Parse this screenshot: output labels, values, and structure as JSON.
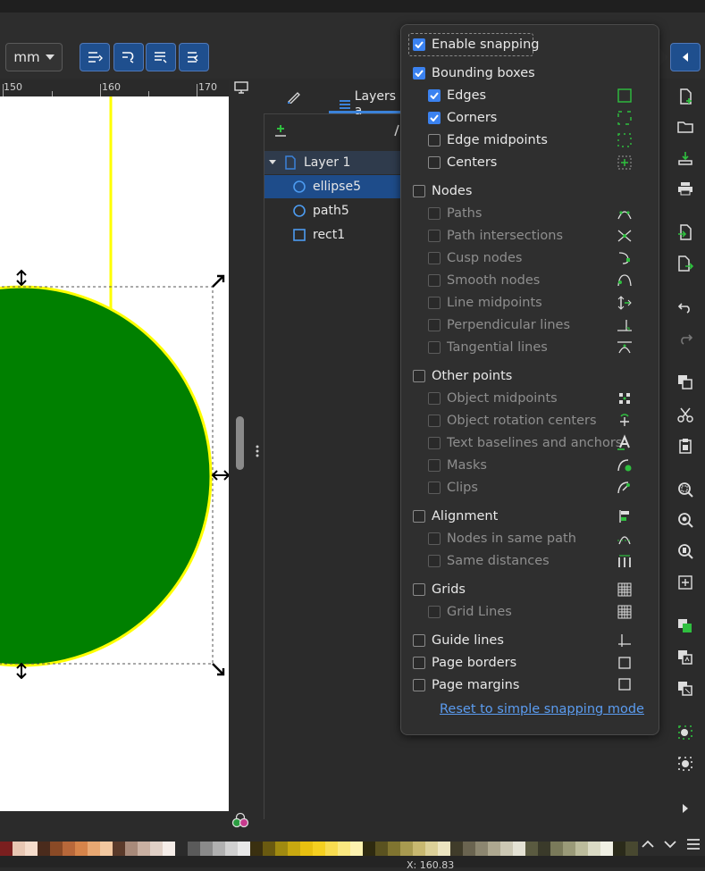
{
  "toolbar": {
    "unit": "mm"
  },
  "ruler": {
    "labels": [
      "150",
      "160",
      "170"
    ]
  },
  "layers_panel": {
    "tab_label": "Layers a",
    "rows": [
      {
        "label": "Layer 1",
        "type": "layer"
      },
      {
        "label": "ellipse5",
        "type": "ellipse",
        "selected": true
      },
      {
        "label": "path5",
        "type": "ellipse"
      },
      {
        "label": "rect1",
        "type": "rect"
      }
    ]
  },
  "snap_popover": {
    "enable": {
      "label": "Enable snapping",
      "checked": true
    },
    "bounding_boxes": {
      "label": "Bounding boxes",
      "checked": true
    },
    "edges": {
      "label": "Edges",
      "checked": true
    },
    "corners": {
      "label": "Corners",
      "checked": true
    },
    "edge_midpoints": {
      "label": "Edge midpoints",
      "checked": false
    },
    "centers": {
      "label": "Centers",
      "checked": false
    },
    "nodes": {
      "label": "Nodes",
      "checked": false
    },
    "paths": {
      "label": "Paths",
      "checked": false
    },
    "path_intersections": {
      "label": "Path intersections",
      "checked": false
    },
    "cusp_nodes": {
      "label": "Cusp nodes",
      "checked": false
    },
    "smooth_nodes": {
      "label": "Smooth nodes",
      "checked": false
    },
    "line_midpoints": {
      "label": "Line midpoints",
      "checked": false
    },
    "perpendicular_lines": {
      "label": "Perpendicular lines",
      "checked": false
    },
    "tangential_lines": {
      "label": "Tangential lines",
      "checked": false
    },
    "other_points": {
      "label": "Other points",
      "checked": false
    },
    "object_midpoints": {
      "label": "Object midpoints",
      "checked": false
    },
    "rotation_centers": {
      "label": "Object rotation centers",
      "checked": false
    },
    "text_baselines": {
      "label": "Text baselines and anchors",
      "checked": false
    },
    "masks": {
      "label": "Masks",
      "checked": false
    },
    "clips": {
      "label": "Clips",
      "checked": false
    },
    "alignment": {
      "label": "Alignment",
      "checked": false
    },
    "nodes_same_path": {
      "label": "Nodes in same path",
      "checked": false
    },
    "same_distances": {
      "label": "Same distances",
      "checked": false
    },
    "grids": {
      "label": "Grids",
      "checked": false
    },
    "grid_lines": {
      "label": "Grid Lines",
      "checked": false
    },
    "guide_lines": {
      "label": "Guide lines",
      "checked": false
    },
    "page_borders": {
      "label": "Page borders",
      "checked": false
    },
    "page_margins": {
      "label": "Page margins",
      "checked": false
    },
    "reset_link": "Reset to simple snapping mode"
  },
  "colors": {
    "accent": "#3b82f0",
    "ellipse_fill": "#008000",
    "ellipse_stroke": "#ffff00",
    "selection_bg": "#1e4c8a",
    "icon_green": "#2fbf3f"
  },
  "status": {
    "x_label": "X: 160.83"
  }
}
